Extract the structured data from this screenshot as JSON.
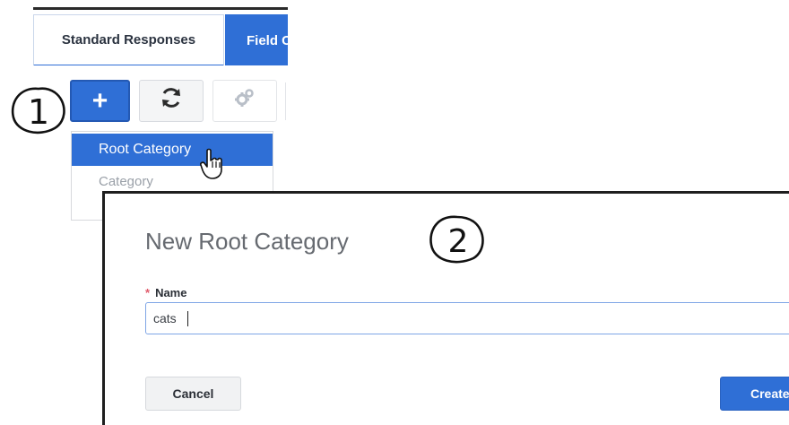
{
  "tabs": [
    {
      "label": "Standard Responses",
      "active": true
    },
    {
      "label": "Field C",
      "active": false
    }
  ],
  "toolbar": {
    "add_symbol": "+",
    "refresh_icon": "refresh-icon",
    "settings_icon": "gear-icon"
  },
  "callouts": {
    "step1": "1",
    "step2": "2"
  },
  "dropdown": {
    "items": [
      {
        "label": "Root Category",
        "highlighted": true
      },
      {
        "label": "Category",
        "highlighted": false
      }
    ]
  },
  "dialog": {
    "title": "New Root Category",
    "name_label": "Name",
    "required_marker": "*",
    "name_value": "cats",
    "cancel_label": "Cancel",
    "create_label": "Create"
  },
  "colors": {
    "accent": "#2f6fd6",
    "required": "#e05a6a"
  }
}
